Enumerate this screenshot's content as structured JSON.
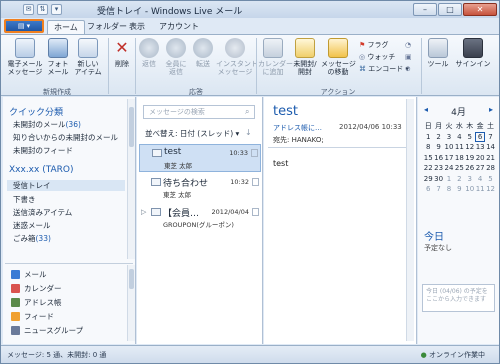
{
  "window": {
    "title": "受信トレイ - Windows Live メール"
  },
  "tabs": [
    {
      "label": "ホーム"
    },
    {
      "label": "フォルダー"
    },
    {
      "label": "表示"
    },
    {
      "label": "アカウント"
    }
  ],
  "ribbon": {
    "new_email": "電子メール\nメッセージ",
    "photo_email": "フォト\nメール",
    "new_items": "新しい\nアイテム",
    "delete": "削除",
    "reply": "返信",
    "reply_all": "全員に\n返信",
    "forward": "転送",
    "instant_message": "インスタント\nメッセージ",
    "add_to_calendar": "カレンダー\nに追加",
    "unread_read": "未開封/\n開封",
    "move_message": "メッセージ\nの移動",
    "flag": "フラグ",
    "watch": "ウォッチ",
    "encode": "エンコード",
    "tools": "ツール",
    "signin": "サインイン",
    "group_new": "新規作成",
    "group_respond": "応答",
    "group_actions": "アクション"
  },
  "folders": {
    "quick_views": "クイック分類",
    "items": [
      {
        "label": "未開封のメール",
        "count": "(36)"
      },
      {
        "label": "知り合いからの未開封のメール",
        "count": ""
      },
      {
        "label": "未開封のフィード",
        "count": ""
      }
    ],
    "account": "Xxx.xx (TARO)",
    "account_items": [
      {
        "label": "受信トレイ",
        "count": ""
      },
      {
        "label": "下書き",
        "count": ""
      },
      {
        "label": "送信済みアイテム",
        "count": ""
      },
      {
        "label": "迷惑メール",
        "count": ""
      },
      {
        "label": "ごみ箱",
        "count": "(33)"
      }
    ]
  },
  "nav": [
    {
      "label": "メール",
      "color": "#3a7bd5"
    },
    {
      "label": "カレンダー",
      "color": "#d9534f"
    },
    {
      "label": "アドレス帳",
      "color": "#5a8a4a"
    },
    {
      "label": "フィード",
      "color": "#f0a030"
    },
    {
      "label": "ニュースグループ",
      "color": "#6a7a9a"
    }
  ],
  "list": {
    "search_placeholder": "メッセージの検索",
    "sort_label": "並べ替え: 日付 (スレッド)",
    "messages": [
      {
        "subject": "test",
        "from": "東芝 太郎",
        "time": "10:33"
      },
      {
        "subject": "待ち合わせ",
        "from": "東芝 太郎",
        "time": "10:32"
      },
      {
        "subject": "【会員…",
        "from": "GROUPON(グルーポン)",
        "time": "2012/04/04"
      }
    ]
  },
  "reading": {
    "subject": "test",
    "from": "アドレス帳に…",
    "date": "2012/04/06 10:33",
    "to": "宛先: HANAKO;",
    "body": "test"
  },
  "calendar": {
    "month": "4月",
    "weekdays": [
      "日",
      "月",
      "火",
      "水",
      "木",
      "金",
      "土"
    ],
    "weeks": [
      [
        "1",
        "2",
        "3",
        "4",
        "5",
        "6",
        "7"
      ],
      [
        "8",
        "9",
        "10",
        "11",
        "12",
        "13",
        "14"
      ],
      [
        "15",
        "16",
        "17",
        "18",
        "19",
        "20",
        "21"
      ],
      [
        "22",
        "23",
        "24",
        "25",
        "26",
        "27",
        "28"
      ],
      [
        "29",
        "30",
        "1",
        "2",
        "3",
        "4",
        "5"
      ],
      [
        "6",
        "7",
        "8",
        "9",
        "10",
        "11",
        "12"
      ]
    ],
    "today_title": "今日",
    "today_none": "予定なし",
    "today_box": "今日 (04/06) の予定をここから入力できます"
  },
  "status": {
    "left": "メッセージ: 5 通、未開封: 0 通",
    "right": "オンライン作業中"
  }
}
